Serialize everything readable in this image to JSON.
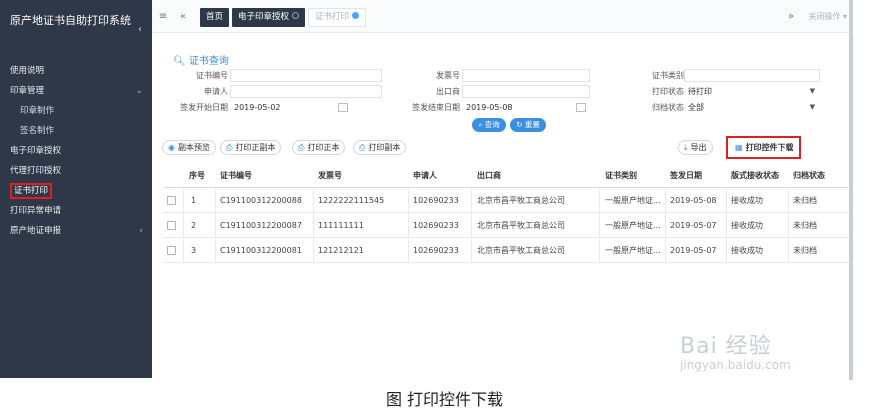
{
  "app": {
    "title": "原产地证书自助打印系统"
  },
  "sidebar": {
    "items": [
      {
        "label": "使用说明"
      },
      {
        "label": "印章管理"
      },
      {
        "label": "印章制作"
      },
      {
        "label": "签名制作"
      },
      {
        "label": "电子印章授权"
      },
      {
        "label": "代理打印授权"
      },
      {
        "label": "证书打印"
      },
      {
        "label": "打印异常申请"
      },
      {
        "label": "原产地证申报"
      }
    ]
  },
  "topbar": {
    "tabs": [
      {
        "label": "首页"
      },
      {
        "label": "电子印章授权"
      },
      {
        "label": "证书打印"
      }
    ],
    "close_ops": "关闭操作"
  },
  "query": {
    "title": "证书查询",
    "fields": {
      "cert_no": {
        "label": "证书编号",
        "value": ""
      },
      "invoice_no": {
        "label": "发票号",
        "value": ""
      },
      "cert_type": {
        "label": "证书类别",
        "value": ""
      },
      "applicant": {
        "label": "申请人",
        "value": ""
      },
      "exporter": {
        "label": "出口商",
        "value": ""
      },
      "print_status": {
        "label": "打印状态",
        "value": "待打印"
      },
      "start_date": {
        "label": "签发开始日期",
        "value": "2019-05-02"
      },
      "end_date": {
        "label": "签发结束日期",
        "value": "2019-05-08"
      },
      "archive_status": {
        "label": "归档状态",
        "value": "全部"
      }
    },
    "search_label": "查询",
    "reset_label": "重置"
  },
  "toolbar": {
    "preview_copy": "副本预览",
    "print_copy": "打印正副本",
    "print_original": "打印正本",
    "print_duplicate": "打印副本",
    "export": "导出",
    "download_plugin": "打印控件下载"
  },
  "table": {
    "columns": [
      "序号",
      "证书编号",
      "发票号",
      "申请人",
      "出口商",
      "证书类别",
      "签发日期",
      "版式接收状态",
      "归档状态"
    ],
    "rows": [
      [
        "1",
        "C191100312200088",
        "1222222111545",
        "102690233",
        "北京市昌平牧工商总公司",
        "一般原产地证...",
        "2019-05-08",
        "接收成功",
        "未归档"
      ],
      [
        "2",
        "C191100312200087",
        "111111111",
        "102690233",
        "北京市昌平牧工商总公司",
        "一般原产地证...",
        "2019-05-07",
        "接收成功",
        "未归档"
      ],
      [
        "3",
        "C191100312200081",
        "121212121",
        "102690233",
        "北京市昌平牧工商总公司",
        "一般原产地证...",
        "2019-05-07",
        "接收成功",
        "未归档"
      ]
    ]
  },
  "watermark": {
    "main": "Bai 经验",
    "sub": "jingyan.baidu.com"
  },
  "caption": "图 打印控件下载",
  "colors": {
    "sidebar": "#2f3848",
    "accent": "#3c8fe0",
    "highlight": "#e02020"
  }
}
